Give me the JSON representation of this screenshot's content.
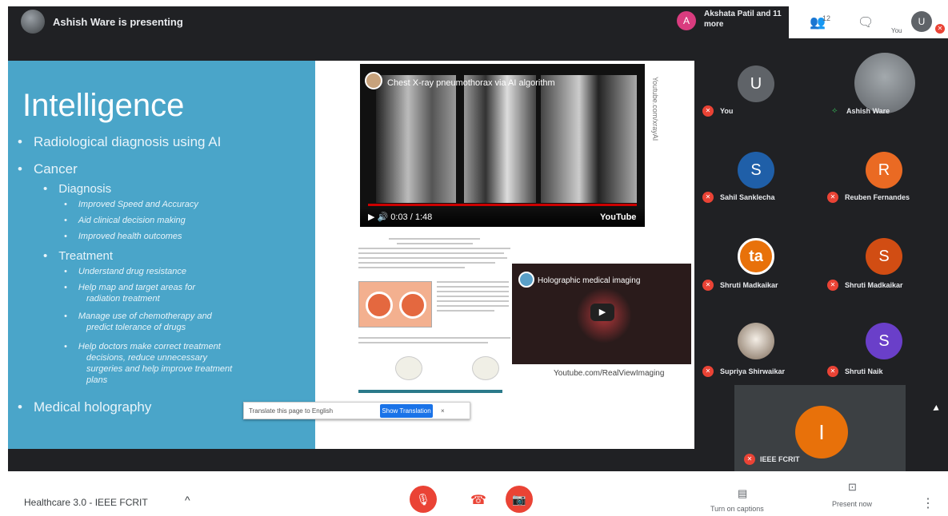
{
  "topbar": {
    "presenting": "Ashish Ware is presenting",
    "joined_avatar": "A",
    "joined": "Akshata Patil and 11 more",
    "count": "12",
    "self_initial": "U",
    "self_label": "You"
  },
  "slide": {
    "title": "Intelligence",
    "bullets": [
      "Radiological diagnosis using AI",
      "Cancer",
      "Diagnosis",
      "Improved Speed and Accuracy",
      "Aid clinical decision making",
      "Improved health outcomes",
      "Treatment",
      "Understand drug resistance",
      "Help map and target areas for",
      "radiation treatment",
      "Manage use of chemotherapy and",
      "predict tolerance of drugs",
      "Help doctors make correct treatment",
      "decisions, reduce unnecessary",
      "surgeries and help improve treatment",
      "plans",
      "Medical holography"
    ],
    "video1_title": "Chest X-ray pneumothorax via AI algorithm",
    "video1_controls": "▶  🔊  0:03 / 1:48",
    "video1_brand": "YouTube",
    "vertical_label": "Youtube.com/xrayAI",
    "video2_title": "Holographic medical imaging",
    "video2_play": "▶",
    "video2_caption": "Youtube.com/RealViewImaging",
    "translate_text": "Translate this page to English",
    "translate_button": "Show Translation",
    "translate_close": "×"
  },
  "participants": [
    {
      "name": "You",
      "initial": "U",
      "color": "#5f6368"
    },
    {
      "name": "Ashish Ware",
      "initial": "",
      "color": "#8a9197"
    },
    {
      "name": "Sahil Sanklecha",
      "initial": "S",
      "color": "#1f5fa8"
    },
    {
      "name": "Reuben Fernandes",
      "initial": "R",
      "color": "#ea6a23"
    },
    {
      "name": "Shruti Madkaikar",
      "initial": "ta",
      "color": "#e8710a"
    },
    {
      "name": "Shruti Madkaikar",
      "initial": "S",
      "color": "#d14d13"
    },
    {
      "name": "Supriya Shirwaikar",
      "initial": "",
      "color": "#c9c2b8"
    },
    {
      "name": "Shruti Naik",
      "initial": "S",
      "color": "#6a3fc9"
    },
    {
      "name": "IEEE FCRIT",
      "initial": "I",
      "color": "#e8710a"
    }
  ],
  "bottombar": {
    "meeting_title": "Healthcare 3.0 - IEEE FCRIT",
    "chevron": "^",
    "captions_label": "Turn on captions",
    "present_label": "Present now"
  }
}
